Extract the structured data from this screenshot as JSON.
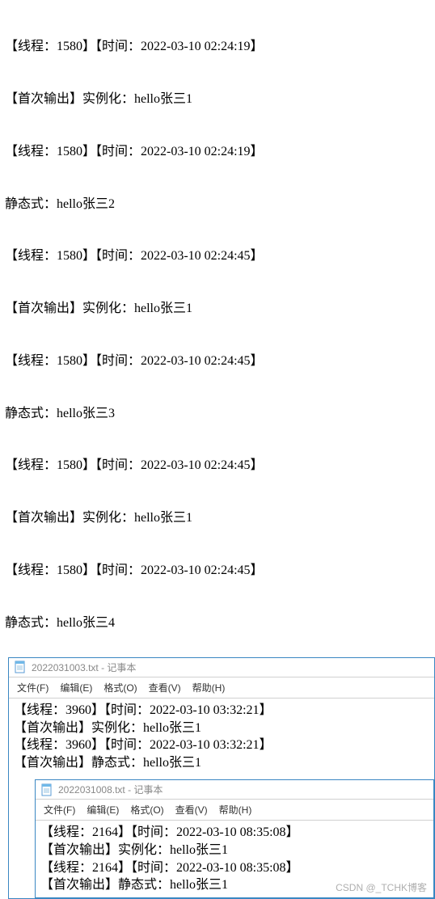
{
  "console": {
    "lines": [
      "【线程：1580】【时间：2022-03-10 02:24:19】",
      "【首次输出】实例化：hello张三1",
      "【线程：1580】【时间：2022-03-10 02:24:19】",
      "静态式：hello张三2",
      "【线程：1580】【时间：2022-03-10 02:24:45】",
      "【首次输出】实例化：hello张三1",
      "【线程：1580】【时间：2022-03-10 02:24:45】",
      "静态式：hello张三3",
      "【线程：1580】【时间：2022-03-10 02:24:45】",
      "【首次输出】实例化：hello张三1",
      "【线程：1580】【时间：2022-03-10 02:24:45】",
      "静态式：hello张三4"
    ]
  },
  "notepad1": {
    "title": "2022031003.txt - 记事本",
    "menu": {
      "file": "文件(F)",
      "edit": "编辑(E)",
      "format": "格式(O)",
      "view": "查看(V)",
      "help": "帮助(H)"
    },
    "lines": [
      "【线程：3960】【时间：2022-03-10 03:32:21】",
      " 【首次输出】实例化：hello张三1",
      "【线程：3960】【时间：2022-03-10 03:32:21】",
      " 【首次输出】静态式：hello张三1"
    ]
  },
  "notepad2": {
    "title": "2022031008.txt - 记事本",
    "menu": {
      "file": "文件(F)",
      "edit": "编辑(E)",
      "format": "格式(O)",
      "view": "查看(V)",
      "help": "帮助(H)"
    },
    "lines": [
      "【线程：2164】【时间：2022-03-10 08:35:08】",
      " 【首次输出】实例化：hello张三1",
      "【线程：2164】【时间：2022-03-10 08:35:08】",
      " 【首次输出】静态式：hello张三1"
    ]
  },
  "watermark": "CSDN @_TCHK博客"
}
